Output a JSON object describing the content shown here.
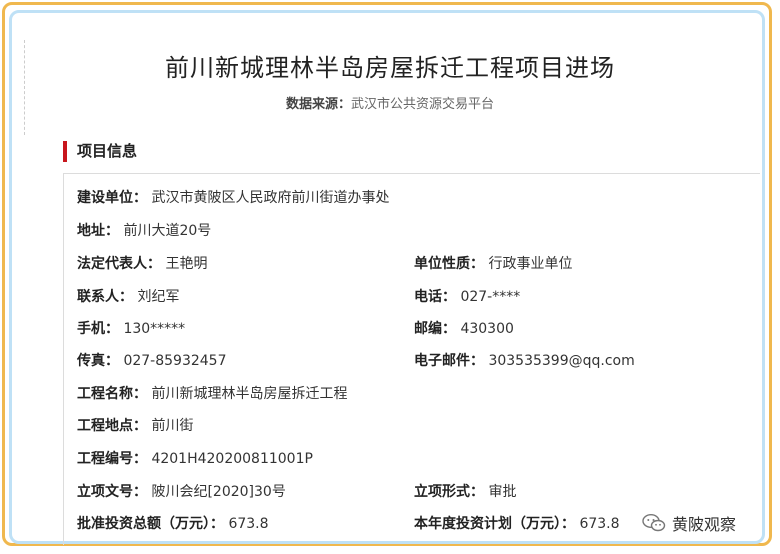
{
  "title": "前川新城理林半岛房屋拆迁工程项目进场",
  "source": {
    "label": "数据来源：",
    "value": "武汉市公共资源交易平台"
  },
  "section": {
    "title": "项目信息"
  },
  "fields": {
    "builder": {
      "label": "建设单位：",
      "value": "武汉市黄陂区人民政府前川街道办事处"
    },
    "address": {
      "label": "地址：",
      "value": "前川大道20号"
    },
    "legal_rep": {
      "label": "法定代表人：",
      "value": "王艳明"
    },
    "unit_type": {
      "label": "单位性质：",
      "value": "行政事业单位"
    },
    "contact": {
      "label": "联系人：",
      "value": "刘纪军"
    },
    "phone": {
      "label": "电话：",
      "value": "027-****"
    },
    "mobile": {
      "label": "手机：",
      "value": "130*****"
    },
    "postcode": {
      "label": "邮编：",
      "value": "430300"
    },
    "fax": {
      "label": "传真：",
      "value": "027-85932457"
    },
    "email": {
      "label": "电子邮件：",
      "value": "303535399@qq.com"
    },
    "project_name": {
      "label": "工程名称：",
      "value": "前川新城理林半岛房屋拆迁工程"
    },
    "project_location": {
      "label": "工程地点：",
      "value": "前川街"
    },
    "project_code": {
      "label": "工程编号：",
      "value": "4201H420200811001P"
    },
    "approval_doc": {
      "label": "立项文号：",
      "value": "陂川会纪[2020]30号"
    },
    "approval_form": {
      "label": "立项形式：",
      "value": "审批"
    },
    "approved_total": {
      "label": "批准投资总额（万元）：",
      "value": "673.8"
    },
    "annual_plan": {
      "label": "本年度投资计划（万元）：",
      "value": "673.8"
    }
  },
  "watermark": {
    "text": "黄陂观察",
    "icon": "wechat-icon"
  },
  "colors": {
    "accent": "#c8161d",
    "outer_frame": "#f0b84e",
    "inner_frame": "#bfe1f6"
  }
}
